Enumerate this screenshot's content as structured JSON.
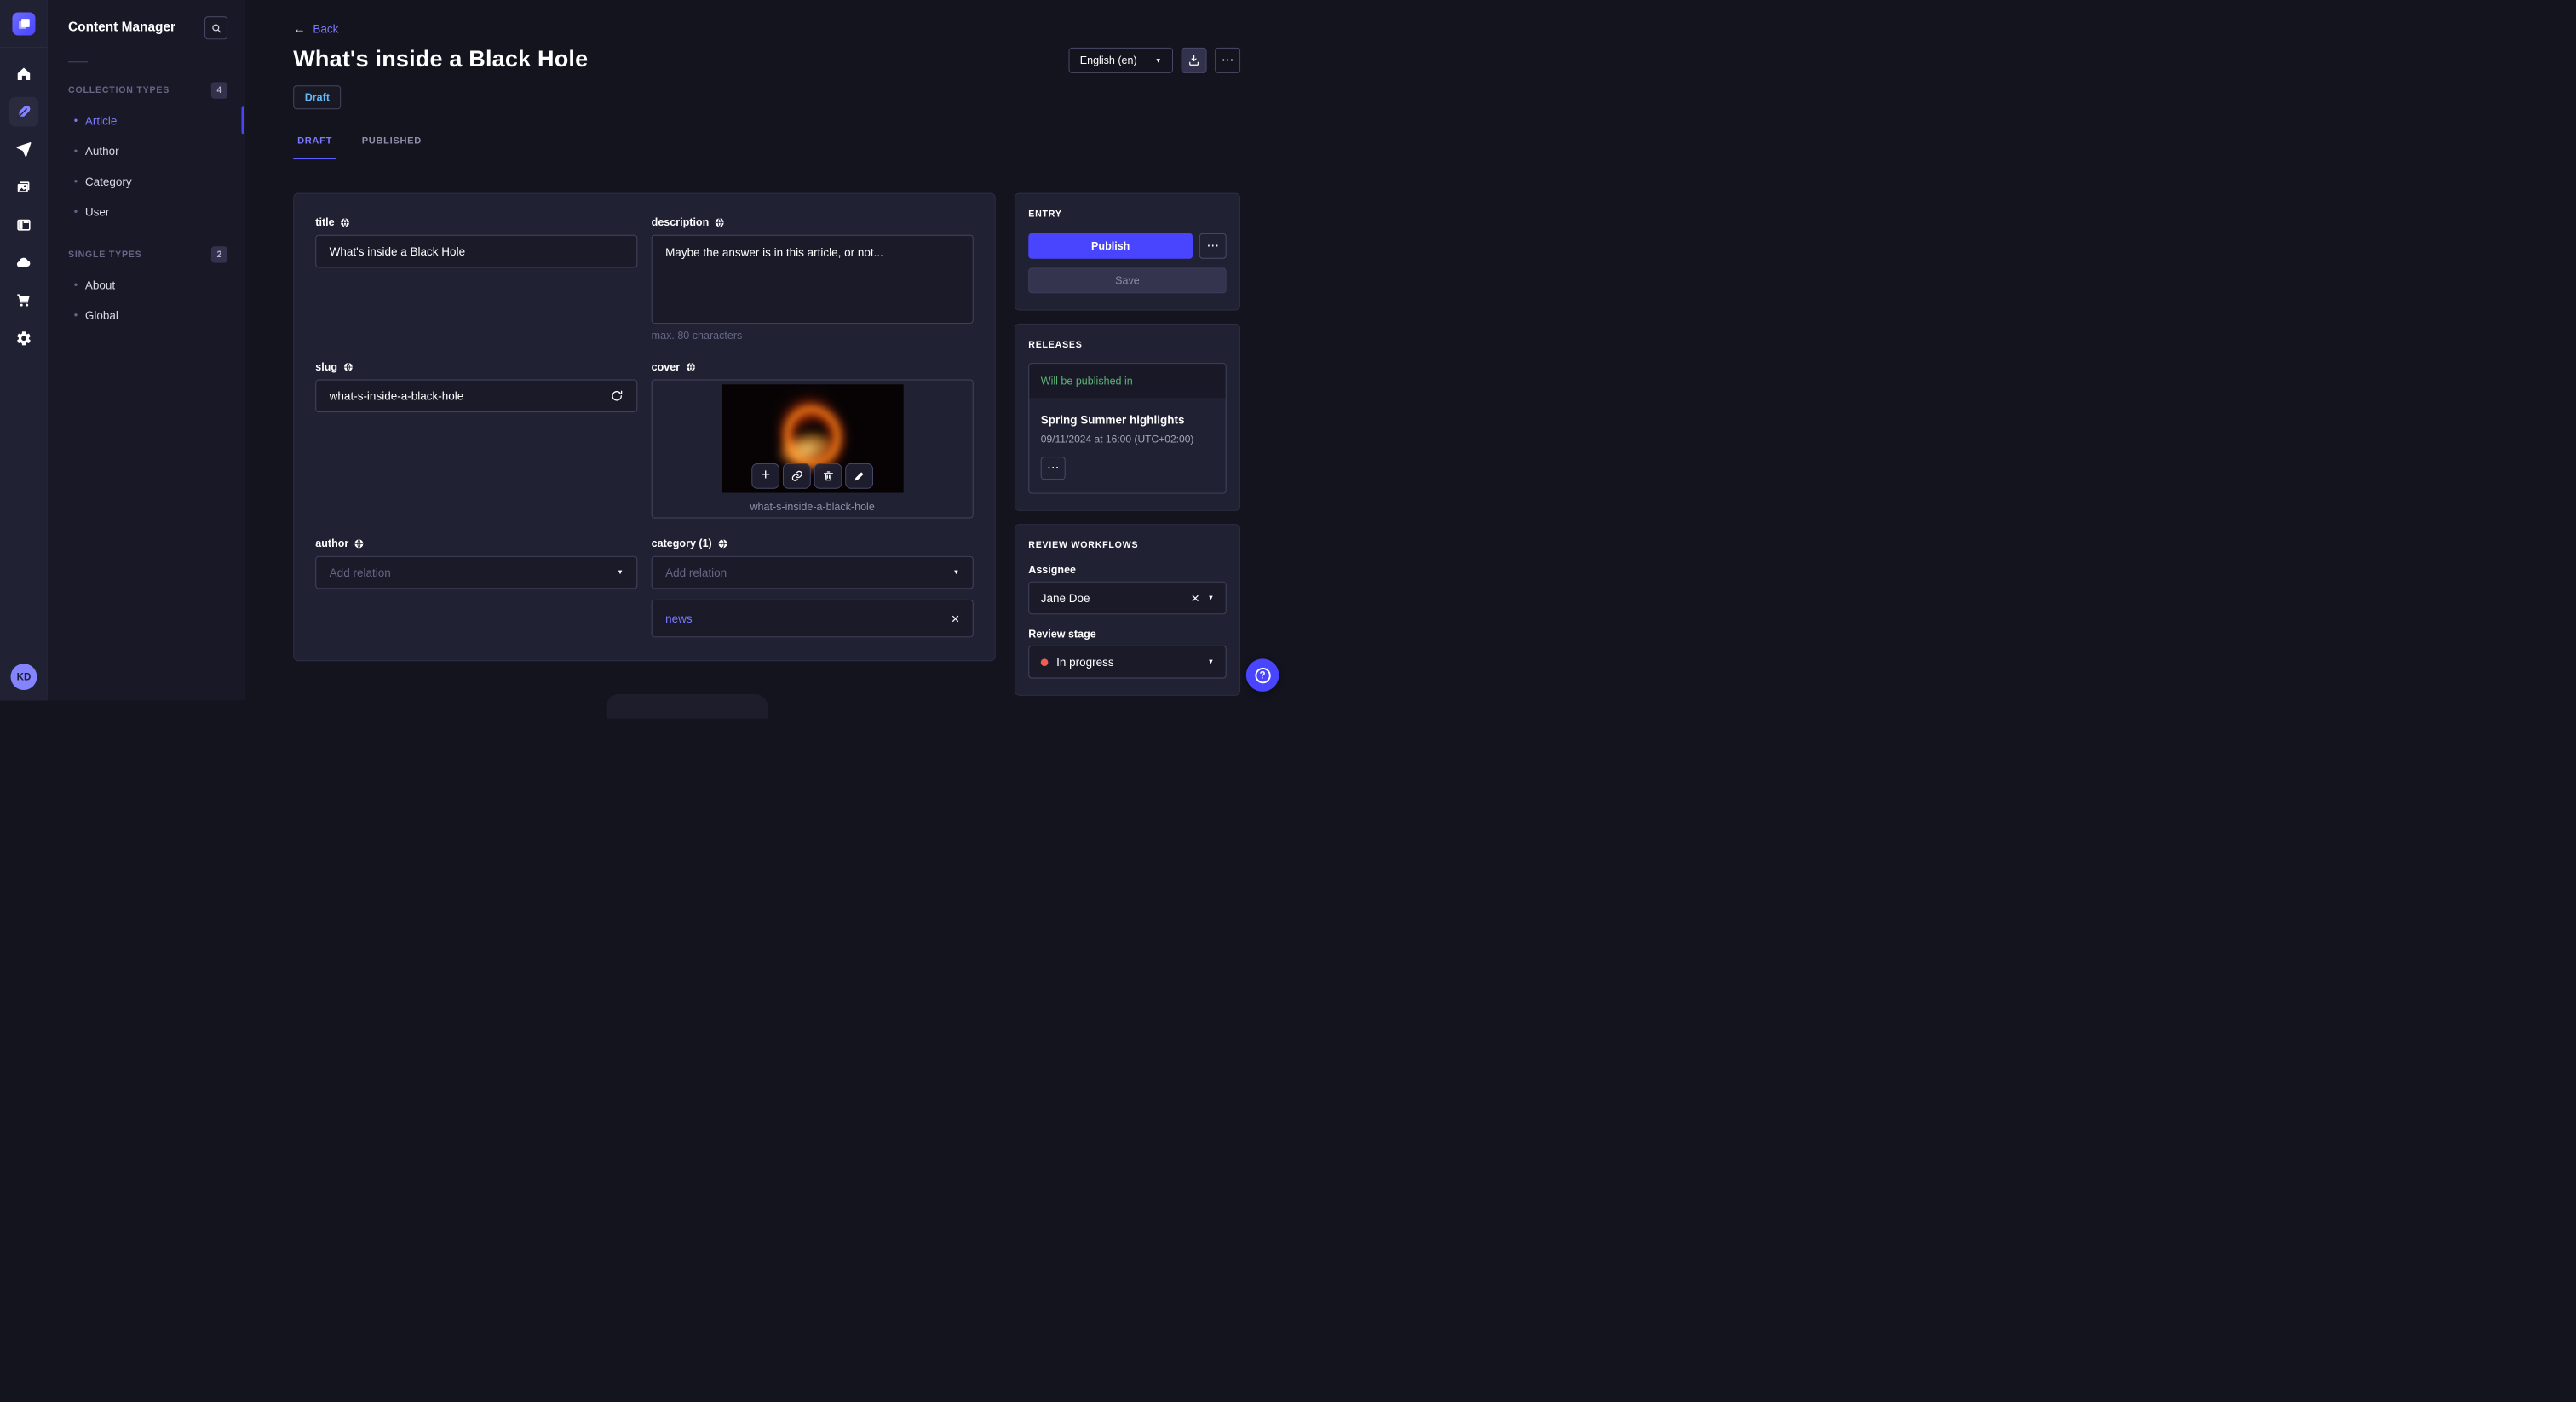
{
  "colors": {
    "accent": "#4945ff",
    "accent_light": "#7b79ff",
    "draft_blue": "#66b7f1",
    "success_green": "#5cb176",
    "danger_red": "#ee5e52"
  },
  "icons": {
    "back_arrow": "←",
    "caret_down": "▼",
    "more_dots": "⋯",
    "close": "×",
    "plus": "+",
    "bullet": "•",
    "help": "?"
  },
  "rail": {
    "avatar_initials": "KD"
  },
  "subnav": {
    "title": "Content Manager",
    "sections": [
      {
        "label": "COLLECTION TYPES",
        "count": "4",
        "items": [
          {
            "label": "Article"
          },
          {
            "label": "Author"
          },
          {
            "label": "Category"
          },
          {
            "label": "User"
          }
        ]
      },
      {
        "label": "SINGLE TYPES",
        "count": "2",
        "items": [
          {
            "label": "About"
          },
          {
            "label": "Global"
          }
        ]
      }
    ]
  },
  "header": {
    "back": "Back",
    "title": "What's inside a Black Hole",
    "status": "Draft",
    "locale": "English (en)",
    "tabs": [
      {
        "label": "DRAFT"
      },
      {
        "label": "PUBLISHED"
      }
    ]
  },
  "form": {
    "title": {
      "label": "title",
      "value": "What's inside a Black Hole"
    },
    "description": {
      "label": "description",
      "value": "Maybe the answer is in this article, or not...",
      "hint": "max. 80 characters"
    },
    "slug": {
      "label": "slug",
      "value": "what-s-inside-a-black-hole"
    },
    "cover": {
      "label": "cover",
      "caption": "what-s-inside-a-black-hole"
    },
    "author": {
      "label": "author",
      "placeholder": "Add relation"
    },
    "category": {
      "label": "category (1)",
      "placeholder": "Add relation",
      "relation": "news"
    }
  },
  "entry": {
    "heading": "ENTRY",
    "publish": "Publish",
    "save": "Save"
  },
  "releases": {
    "heading": "RELEASES",
    "card": {
      "status": "Will be published in",
      "name": "Spring Summer highlights",
      "date": "09/11/2024 at 16:00 (UTC+02:00)"
    }
  },
  "review": {
    "heading": "REVIEW WORKFLOWS",
    "assignee_label": "Assignee",
    "assignee": "Jane Doe",
    "stage_label": "Review stage",
    "stage": "In progress"
  }
}
